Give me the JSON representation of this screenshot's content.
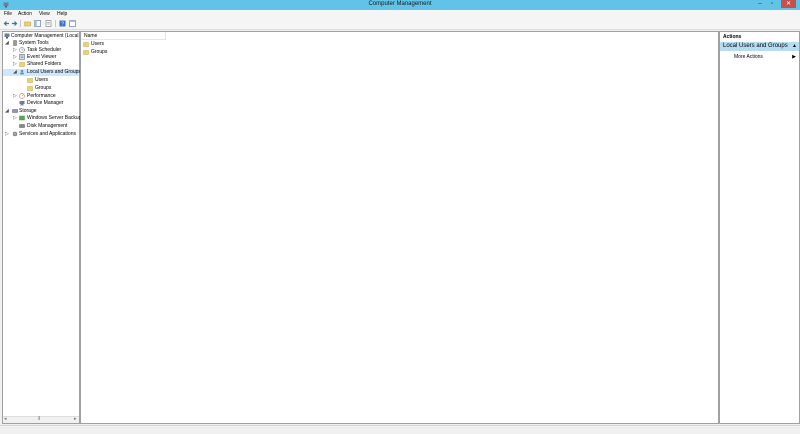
{
  "window": {
    "title": "Computer Management",
    "minimize": "‒",
    "restore": "▫",
    "close": "✕"
  },
  "menu": [
    "File",
    "Action",
    "View",
    "Help"
  ],
  "tree": {
    "root": "Computer Management (Local",
    "system_tools": "System Tools",
    "task_scheduler": "Task Scheduler",
    "event_viewer": "Event Viewer",
    "shared_folders": "Shared Folders",
    "local_users_groups": "Local Users and Groups",
    "users": "Users",
    "groups": "Groups",
    "performance": "Performance",
    "device_manager": "Device Manager",
    "storage": "Storage",
    "windows_server_backup": "Windows Server Backup",
    "disk_management": "Disk Management",
    "services_apps": "Services and Applications"
  },
  "list": {
    "column_name": "Name",
    "rows": [
      "Users",
      "Groups"
    ]
  },
  "actions": {
    "title": "Actions",
    "section": "Local Users and Groups",
    "more_actions": "More Actions"
  },
  "colors": {
    "titlebar": "#5fc4e8",
    "selection": "#cce8ff",
    "close": "#c7504c",
    "folder": "#f2d16b"
  }
}
